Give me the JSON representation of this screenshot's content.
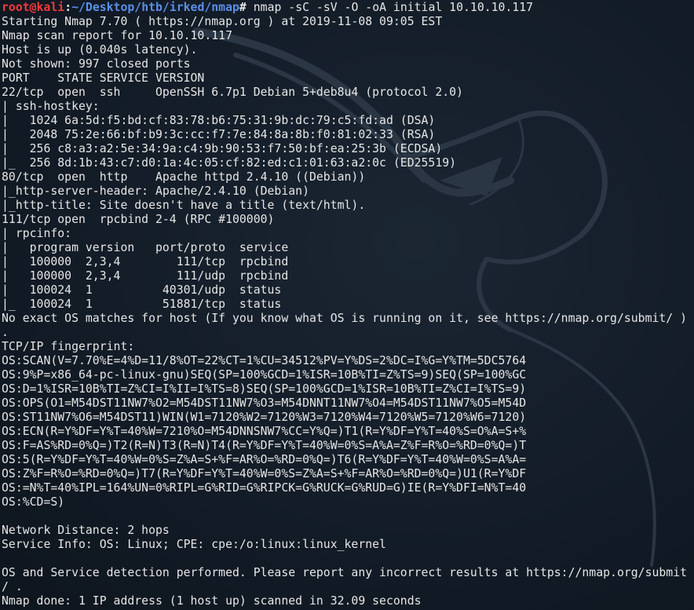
{
  "colors": {
    "background": "#121b26",
    "text": "#e6e6e6",
    "prompt_user": "#ef3b3b",
    "prompt_path": "#5b8fe8"
  },
  "prompt": {
    "user_host": "root@kali",
    "separator": ":",
    "path": "~/Desktop/htb/irked/nmap",
    "symbol": "# ",
    "command": "nmap -sC -sV -O -oA initial 10.10.10.117"
  },
  "output": [
    "Starting Nmap 7.70 ( https://nmap.org ) at 2019-11-08 09:05 EST",
    "Nmap scan report for 10.10.10.117",
    "Host is up (0.040s latency).",
    "Not shown: 997 closed ports",
    "PORT    STATE SERVICE VERSION",
    "22/tcp  open  ssh     OpenSSH 6.7p1 Debian 5+deb8u4 (protocol 2.0)",
    "| ssh-hostkey: ",
    "|   1024 6a:5d:f5:bd:cf:83:78:b6:75:31:9b:dc:79:c5:fd:ad (DSA)",
    "|   2048 75:2e:66:bf:b9:3c:cc:f7:7e:84:8a:8b:f0:81:02:33 (RSA)",
    "|   256 c8:a3:a2:5e:34:9a:c4:9b:90:53:f7:50:bf:ea:25:3b (ECDSA)",
    "|_  256 8d:1b:43:c7:d0:1a:4c:05:cf:82:ed:c1:01:63:a2:0c (ED25519)",
    "80/tcp  open  http    Apache httpd 2.4.10 ((Debian))",
    "|_http-server-header: Apache/2.4.10 (Debian)",
    "|_http-title: Site doesn't have a title (text/html).",
    "111/tcp open  rpcbind 2-4 (RPC #100000)",
    "| rpcinfo: ",
    "|   program version   port/proto  service",
    "|   100000  2,3,4        111/tcp  rpcbind",
    "|   100000  2,3,4        111/udp  rpcbind",
    "|   100024  1          40301/udp  status",
    "|_  100024  1          51881/tcp  status",
    "No exact OS matches for host (If you know what OS is running on it, see https://nmap.org/submit/ )",
    ".",
    "TCP/IP fingerprint:",
    "OS:SCAN(V=7.70%E=4%D=11/8%OT=22%CT=1%CU=34512%PV=Y%DS=2%DC=I%G=Y%TM=5DC5764",
    "OS:9%P=x86_64-pc-linux-gnu)SEQ(SP=100%GCD=1%ISR=10B%TI=Z%TS=9)SEQ(SP=100%GC",
    "OS:D=1%ISR=10B%TI=Z%CI=I%II=I%TS=8)SEQ(SP=100%GCD=1%ISR=10B%TI=Z%CI=I%TS=9)",
    "OS:OPS(O1=M54DST11NW7%O2=M54DST11NW7%O3=M54DNNT11NW7%O4=M54DST11NW7%O5=M54D",
    "OS:ST11NW7%O6=M54DST11)WIN(W1=7120%W2=7120%W3=7120%W4=7120%W5=7120%W6=7120)",
    "OS:ECN(R=Y%DF=Y%T=40%W=7210%O=M54DNNSNW7%CC=Y%Q=)T1(R=Y%DF=Y%T=40%S=O%A=S+%",
    "OS:F=AS%RD=0%Q=)T2(R=N)T3(R=N)T4(R=Y%DF=Y%T=40%W=0%S=A%A=Z%F=R%O=%RD=0%Q=)T",
    "OS:5(R=Y%DF=Y%T=40%W=0%S=Z%A=S+%F=AR%O=%RD=0%Q=)T6(R=Y%DF=Y%T=40%W=0%S=A%A=",
    "OS:Z%F=R%O=%RD=0%Q=)T7(R=Y%DF=Y%T=40%W=0%S=Z%A=S+%F=AR%O=%RD=0%Q=)U1(R=Y%DF",
    "OS:=N%T=40%IPL=164%UN=0%RIPL=G%RID=G%RIPCK=G%RUCK=G%RUD=G)IE(R=Y%DFI=N%T=40",
    "OS:%CD=S)",
    "",
    "Network Distance: 2 hops",
    "Service Info: OS: Linux; CPE: cpe:/o:linux:linux_kernel",
    "",
    "OS and Service detection performed. Please report any incorrect results at https://nmap.org/submit",
    "/ .",
    "Nmap done: 1 IP address (1 host up) scanned in 32.09 seconds"
  ]
}
